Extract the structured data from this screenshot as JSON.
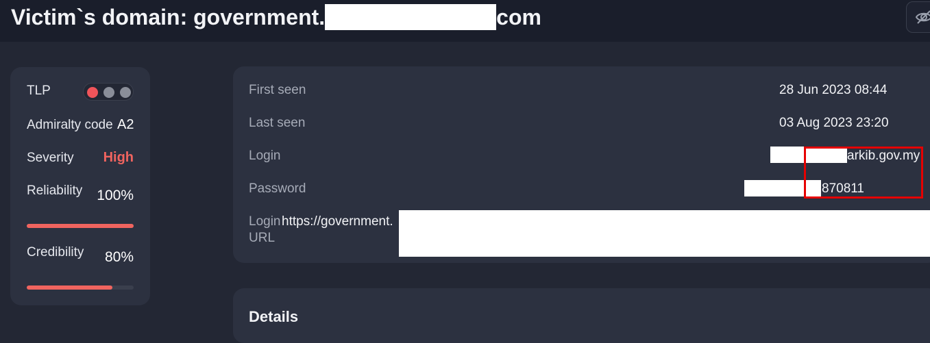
{
  "header": {
    "title_prefix": "Victim`s domain: government.",
    "title_suffix": "com",
    "hide_icon": "eye-off-icon"
  },
  "summary": {
    "tlp_label": "TLP",
    "tlp_dots": [
      "#f0545a",
      "#8a8e99",
      "#8a8e99"
    ],
    "admiralty_label": "Admiralty code",
    "admiralty_value": "A2",
    "severity_label": "Severity",
    "severity_value": "High",
    "severity_color": "#f0645f",
    "reliability_label": "Reliability",
    "reliability_value": "100%",
    "reliability_level": 1.0,
    "credibility_label": "Credibility",
    "credibility_value": "80%",
    "credibility_level": 0.8
  },
  "details": {
    "first_seen_label": "First seen",
    "first_seen_value": "28 Jun 2023 08:44",
    "last_seen_label": "Last seen",
    "last_seen_value": "03 Aug 2023 23:20",
    "login_label": "Login",
    "login_value_visible": "arkib.gov.my",
    "password_label": "Password",
    "password_value_visible": "870811",
    "login_url_label_1": "Login",
    "login_url_label_2": "URL",
    "login_url_value_visible": "https://government."
  },
  "section": {
    "details_title": "Details"
  }
}
